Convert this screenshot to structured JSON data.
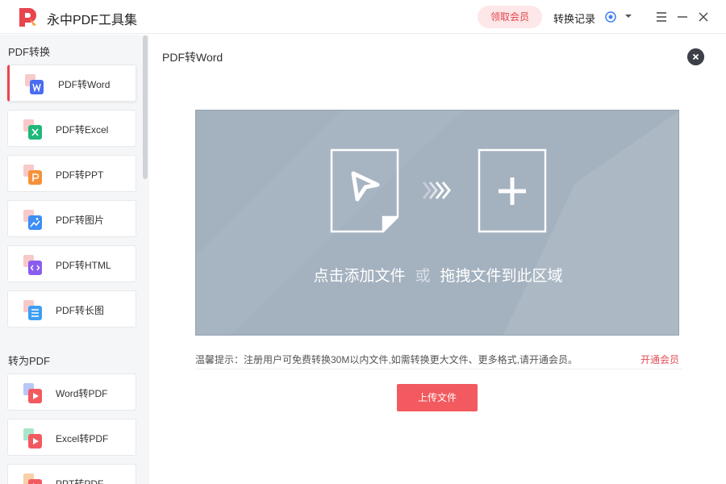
{
  "app": {
    "title": "永中PDF工具集"
  },
  "header": {
    "vip_label": "领取会员",
    "history_label": "转换记录"
  },
  "sidebar": {
    "section1_title": "PDF转换",
    "section2_title": "转为PDF",
    "items": [
      {
        "label": "PDF转Word",
        "icon": "word-doc-icon",
        "color": "#4a6cf0"
      },
      {
        "label": "PDF转Excel",
        "icon": "excel-doc-icon",
        "color": "#1fb87a"
      },
      {
        "label": "PDF转PPT",
        "icon": "ppt-doc-icon",
        "color": "#f5913a"
      },
      {
        "label": "PDF转图片",
        "icon": "image-doc-icon",
        "color": "#3d8ef5"
      },
      {
        "label": "PDF转HTML",
        "icon": "html-doc-icon",
        "color": "#8a5cf0"
      },
      {
        "label": "PDF转长图",
        "icon": "long-image-doc-icon",
        "color": "#3d9ef5"
      },
      {
        "label": "Word转PDF",
        "icon": "word-to-pdf-icon",
        "color": "#f25a5f"
      },
      {
        "label": "Excel转PDF",
        "icon": "excel-to-pdf-icon",
        "color": "#f25a5f"
      },
      {
        "label": "PPT转PDF",
        "icon": "ppt-to-pdf-icon",
        "color": "#f25a5f"
      }
    ]
  },
  "main": {
    "title": "PDF转Word",
    "drop_add": "点击添加文件",
    "drop_or": "或",
    "drop_drag": "拖拽文件到此区域",
    "tip": "温馨提示：注册用户可免费转换30M以内文件,如需转换更大文件、更多格式,请开通会员。",
    "tip_link": "开通会员",
    "upload_label": "上传文件"
  },
  "colors": {
    "accent": "#f25a5f",
    "dropzone": "#a4b1bf"
  }
}
